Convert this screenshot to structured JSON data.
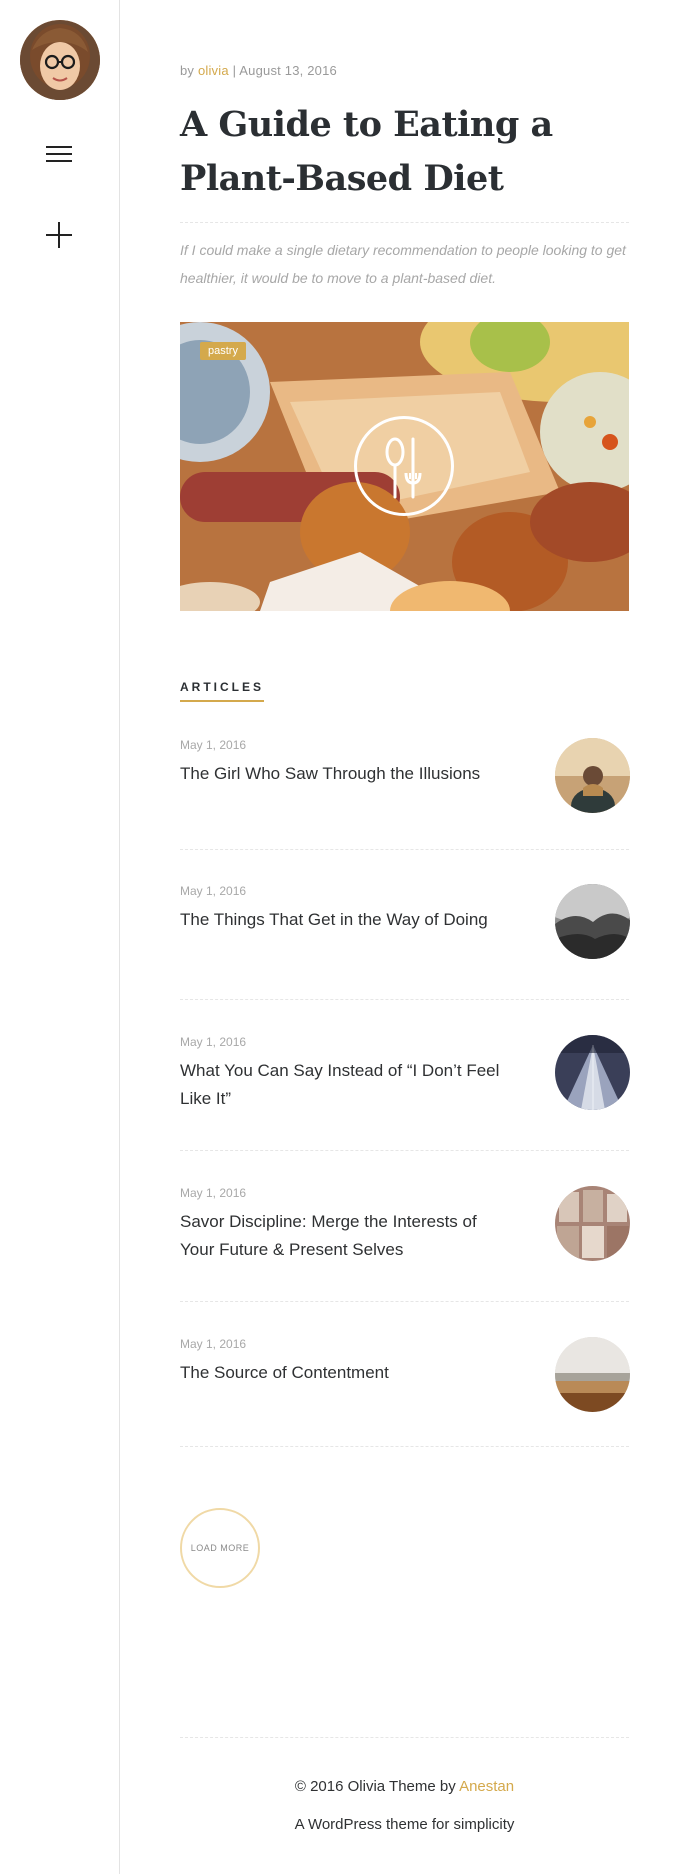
{
  "sidebar": {
    "avatar_alt": "olivia",
    "icons": [
      "hamburger-menu-icon",
      "plus-icon"
    ]
  },
  "post": {
    "by_label": "by",
    "author": "olivia",
    "separator": "|",
    "date": "August 13, 2016",
    "title": "A Guide to Eating a Plant-Based Diet",
    "excerpt": "If I could make a single dietary recommendation to people looking to get healthier, it would be to move to a plant-based diet.",
    "category": "pastry",
    "format_icon": "utensils-icon"
  },
  "articles": {
    "heading": "ARTICLES",
    "items": [
      {
        "date": "May 1, 2016",
        "title": "The Girl Who Saw Through the Illusions",
        "thumb": "person-sunset-photo"
      },
      {
        "date": "May 1, 2016",
        "title": "The Things That Get in the Way of Doing",
        "thumb": "foggy-forest-photo"
      },
      {
        "date": "May 1, 2016",
        "title": "What You Can Say Instead of “I Don’t Feel Like It”",
        "thumb": "skyscraper-photo"
      },
      {
        "date": "May 1, 2016",
        "title": "Savor Discipline: Merge the Interests of Your Future & Present Selves",
        "thumb": "books-stack-photo"
      },
      {
        "date": "May 1, 2016",
        "title": "The Source of Contentment",
        "thumb": "beach-landscape-photo"
      }
    ]
  },
  "load_more": "LOAD MORE",
  "footer": {
    "copyright": "© 2016 Olivia Theme by",
    "author_link": "Anestan",
    "tagline": "A WordPress theme for simplicity"
  },
  "colors": {
    "accent": "#d4a94c",
    "text": "#2f3133",
    "muted": "#a8a8a8",
    "border": "#e3e3e3"
  }
}
